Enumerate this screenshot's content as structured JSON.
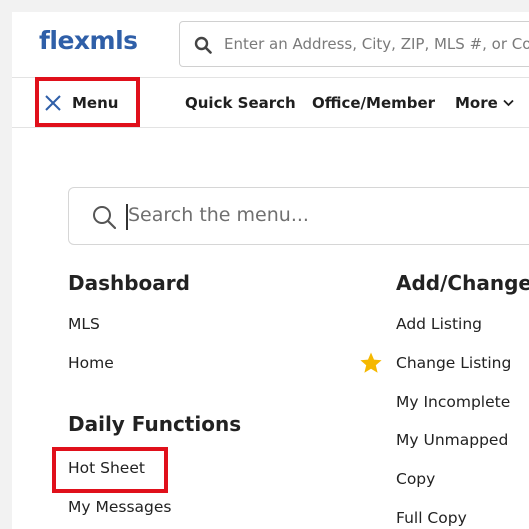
{
  "header": {
    "logo_text": "flexmls",
    "search_placeholder": "Enter an Address, City, ZIP, MLS #, or Co"
  },
  "nav": {
    "menu_label": "Menu",
    "items": [
      "Quick Search",
      "Office/Member",
      "More"
    ]
  },
  "menu_search": {
    "placeholder": "Search the menu..."
  },
  "sections": {
    "dashboard": {
      "title": "Dashboard",
      "items": [
        "MLS",
        "Home"
      ]
    },
    "daily_functions": {
      "title": "Daily Functions",
      "items": [
        "Hot Sheet",
        "My Messages"
      ]
    },
    "add_change": {
      "title": "Add/Change",
      "items": [
        "Add Listing",
        "Change Listing",
        "My Incomplete",
        "My Unmapped",
        "Copy",
        "Full Copy"
      ]
    }
  },
  "colors": {
    "brand": "#2f5fa8",
    "highlight": "#e0101b",
    "star": "#f5b800"
  },
  "icons": {
    "search": "search-icon",
    "close": "close-icon",
    "chevron": "chevron-down-icon",
    "favorite": "star-icon"
  }
}
